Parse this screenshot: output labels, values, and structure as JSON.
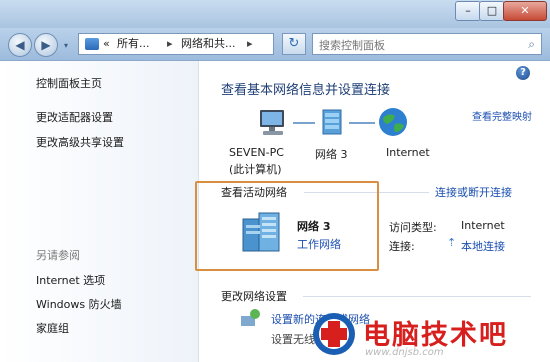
{
  "window": {
    "min_glyph": "–",
    "max_glyph": "□",
    "close_glyph": "✕"
  },
  "navbar": {
    "back_glyph": "◀",
    "forward_glyph": "▶",
    "address": {
      "separator": "«",
      "crumbs": [
        "所有...",
        "网络和共..."
      ],
      "arrows": [
        "▸",
        "▸"
      ]
    },
    "refresh_glyph": "↻",
    "search_placeholder": "搜索控制面板"
  },
  "sidebar": {
    "items": [
      {
        "label": "控制面板主页"
      },
      {
        "label": "更改适配器设置"
      },
      {
        "label": "更改高级共享设置"
      }
    ],
    "see_also_label": "另请参阅",
    "see_also_items": [
      {
        "label": "Internet 选项"
      },
      {
        "label": "Windows 防火墙"
      },
      {
        "label": "家庭组"
      }
    ]
  },
  "main": {
    "help_glyph": "?",
    "title": "查看基本网络信息并设置连接",
    "full_map_link": "查看完整映射",
    "nodes": [
      {
        "label_line1": "SEVEN-PC",
        "label_line2": "(此计算机)",
        "icon": "computer-icon"
      },
      {
        "label_line1": "网络  3",
        "label_line2": "",
        "icon": "network-icon"
      },
      {
        "label_line1": "Internet",
        "label_line2": "",
        "icon": "globe-icon"
      }
    ],
    "active_networks_label": "查看活动网络",
    "connect_disconnect_link": "连接或断开连接",
    "network": {
      "name": "网络  3",
      "type": "工作网络",
      "access_type_label": "访问类型:",
      "access_type_value": "Internet",
      "connections_label": "连接:",
      "connections_value": "本地连接"
    },
    "change_settings_label": "更改网络设置",
    "change_items": [
      {
        "label": "设置新的连接或网络"
      },
      {
        "label": "设置无线..."
      }
    ]
  },
  "watermark": {
    "text": "电脑技术吧",
    "url": "www.dnjsb.com"
  },
  "colors": {
    "accent": "#1b4fb0",
    "highlight_box": "#d89040",
    "watermark_red": "#d7201e"
  }
}
